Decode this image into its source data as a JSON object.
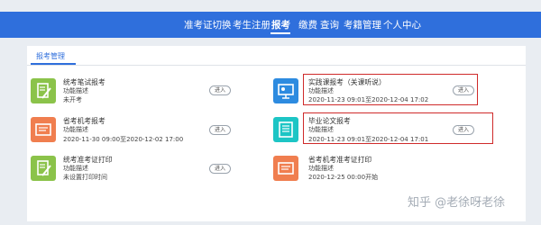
{
  "nav": {
    "items": [
      "准考证切换",
      "考生注册",
      "报考",
      "缴费",
      "查询",
      "考籍管理",
      "个人中心"
    ],
    "active": "报考"
  },
  "panel": {
    "tab": "报考管理"
  },
  "enter_label": "进入",
  "cards": [
    {
      "title": "统考笔试报考",
      "desc": "功能描述",
      "date": "未开考"
    },
    {
      "title": "实践课报考（关课听说）",
      "desc": "功能描述",
      "date": "2020-11-23 09:01至2020-12-04 17:02"
    },
    {
      "title": "省考机考报考",
      "desc": "功能描述",
      "date": "2020-11-30 09:00至2020-12-02 17:00"
    },
    {
      "title": "毕业论文报考",
      "desc": "功能描述",
      "date": "2020-11-23 09:01至2020-12-04 17:01"
    },
    {
      "title": "统考准考证打印",
      "desc": "功能描述",
      "date": "未设置打印时间"
    },
    {
      "title": "省考机考准考证打印",
      "desc": "功能描述",
      "date": "2020-12-25 00:00开始"
    }
  ],
  "icons": [
    "pencil-paper-icon",
    "presentation-icon",
    "certificate-icon",
    "document-list-icon",
    "pencil-paper-icon",
    "certificate-icon"
  ],
  "watermark": "知乎 @老徐呀老徐",
  "colors": {
    "nav": "#2f6fdc",
    "highlight": "#cf2a2a",
    "green": "#8bc34a",
    "orange": "#f07e4f",
    "blue": "#2d8be0",
    "teal": "#1dc5c5"
  }
}
